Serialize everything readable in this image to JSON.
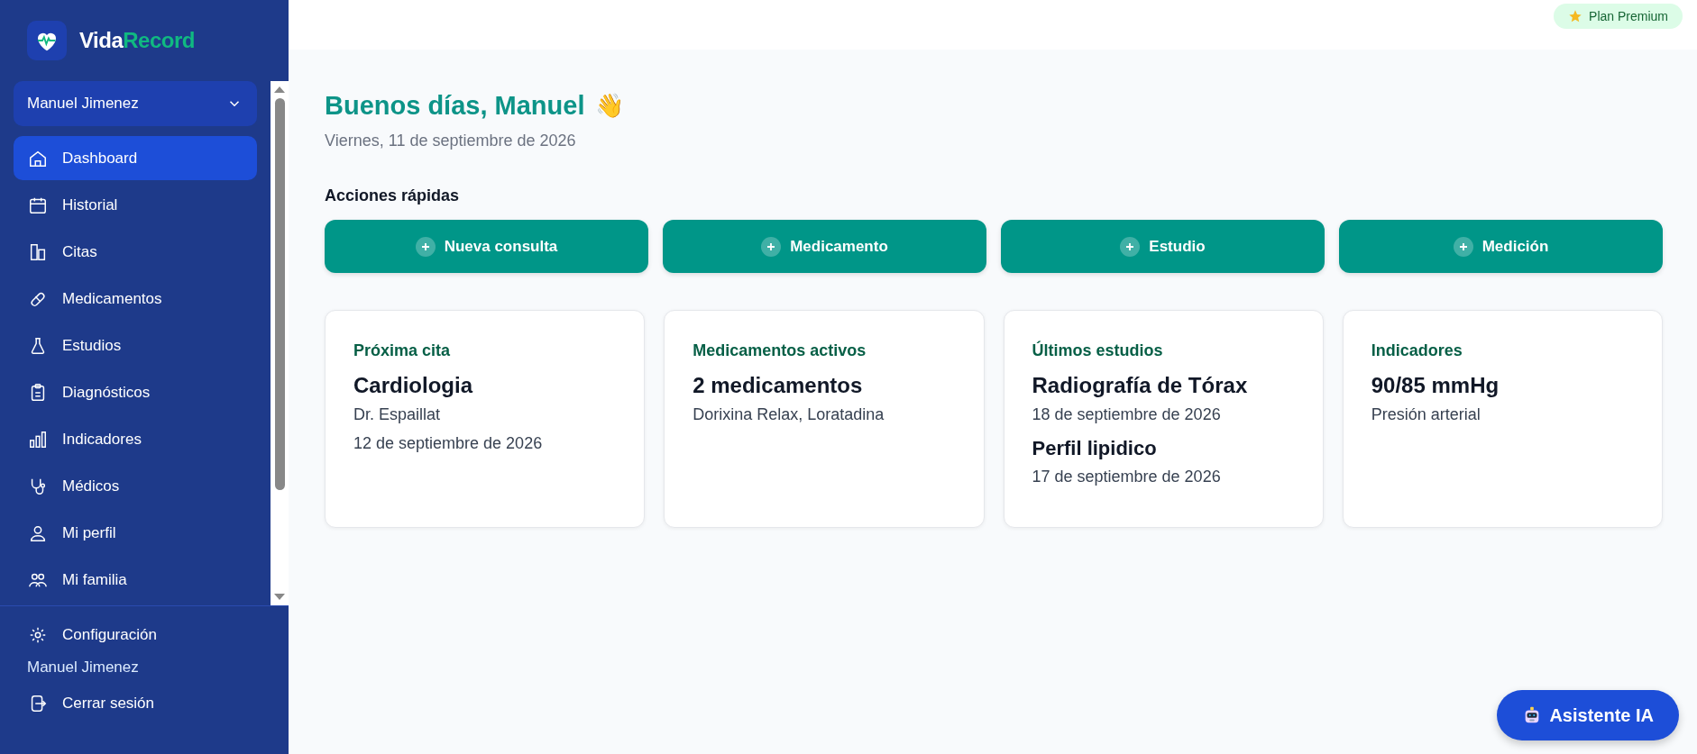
{
  "brand": {
    "name_part_1": "Vida",
    "name_part_2": "Record"
  },
  "user_selector": {
    "value": "Manuel Jimenez"
  },
  "nav": [
    {
      "label": "Dashboard",
      "selected": true
    },
    {
      "label": "Historial",
      "selected": false
    },
    {
      "label": "Citas",
      "selected": false
    },
    {
      "label": "Medicamentos",
      "selected": false
    },
    {
      "label": "Estudios",
      "selected": false
    },
    {
      "label": "Diagnósticos",
      "selected": false
    },
    {
      "label": "Indicadores",
      "selected": false
    },
    {
      "label": "Médicos",
      "selected": false
    },
    {
      "label": "Mi perfil",
      "selected": false
    },
    {
      "label": "Mi familia",
      "selected": false
    }
  ],
  "footer": {
    "settings": "Configuración",
    "user_name": "Manuel Jimenez",
    "logout": "Cerrar sesión"
  },
  "plan_badge": "Plan Premium",
  "greeting": {
    "title": "Buenos días, Manuel",
    "emoji": "👋",
    "date": "Viernes, 11 de septiembre de 2026"
  },
  "quick_actions": {
    "title": "Acciones rápidas",
    "buttons": [
      "Nueva consulta",
      "Medicamento",
      "Estudio",
      "Medición"
    ]
  },
  "cards": [
    {
      "title": "Próxima cita",
      "entries": [
        {
          "heading": "Cardiologia",
          "lines": [
            "Dr. Espaillat",
            "12 de septiembre de 2026"
          ]
        }
      ]
    },
    {
      "title": "Medicamentos activos",
      "entries": [
        {
          "heading": "2 medicamentos",
          "lines": [
            "Dorixina Relax, Loratadina"
          ]
        }
      ]
    },
    {
      "title": "Últimos estudios",
      "entries": [
        {
          "heading": "Radiografía de Tórax",
          "lines": [
            "18 de septiembre de 2026"
          ]
        },
        {
          "heading": "Perfil lipidico",
          "lines": [
            "17 de septiembre de 2026"
          ]
        }
      ]
    },
    {
      "title": "Indicadores",
      "entries": [
        {
          "heading": "90/85 mmHg",
          "lines": [
            "Presión arterial"
          ]
        }
      ]
    }
  ],
  "assistant_button": "Asistente IA"
}
